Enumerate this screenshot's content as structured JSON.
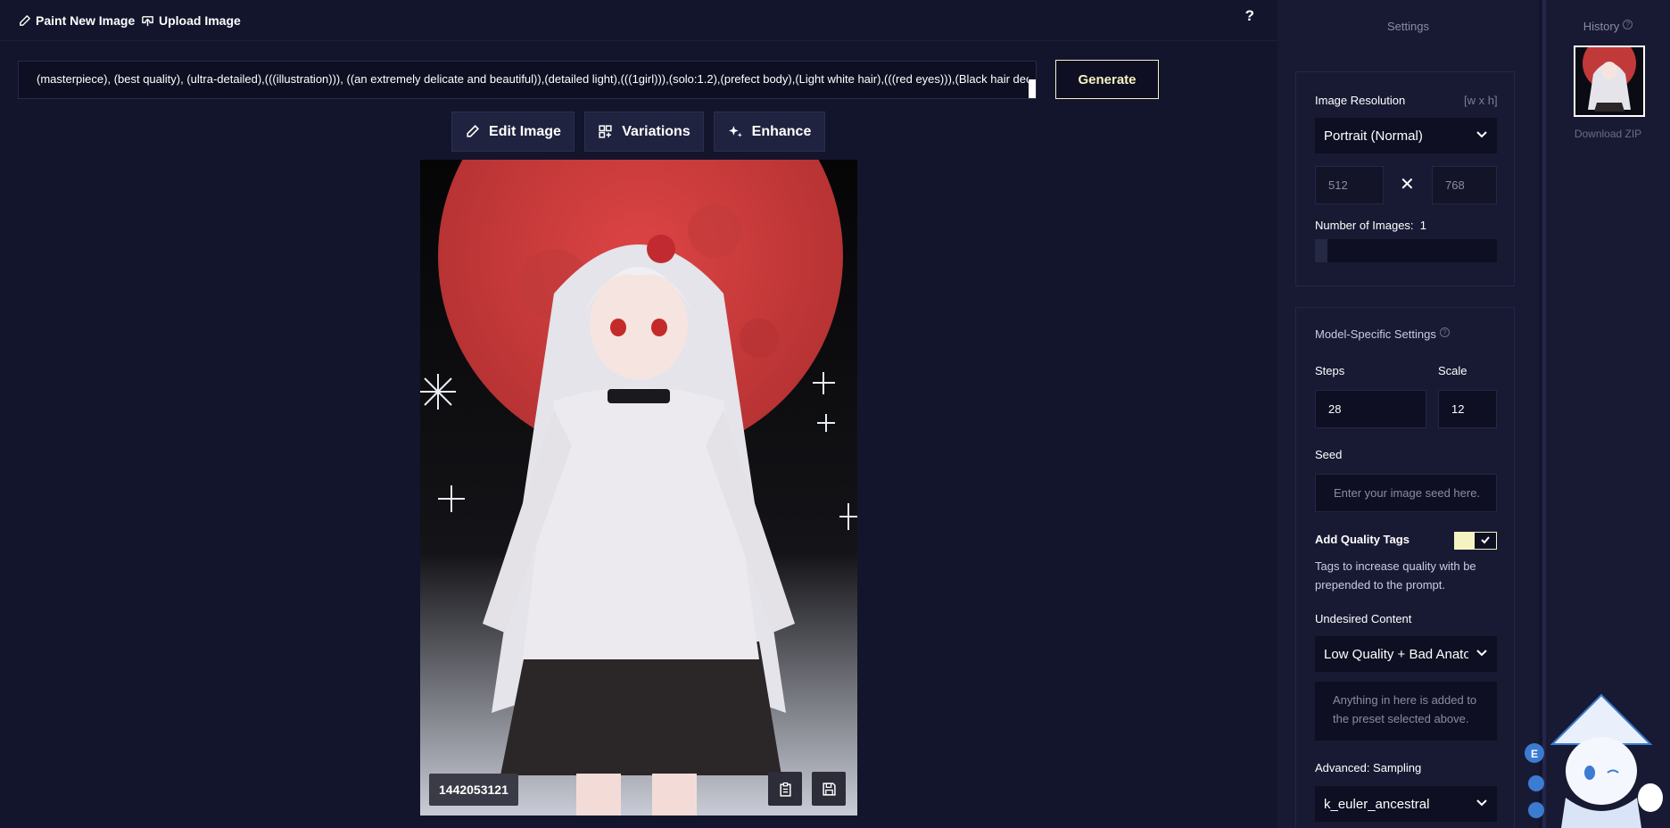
{
  "topbar": {
    "paint_new": "Paint New Image",
    "upload": "Upload Image",
    "help": "?"
  },
  "prompt": {
    "value": "(masterpiece), (best quality), (ultra-detailed),(((illustration))), ((an extremely delicate and beautiful)),(detailed light),(((1girl))),(solo:1.2),(prefect body),(Light white hair),(((red eyes))),(Black hair decoration),(black choker),white sweater,black skirt,blood moon,snowflakes"
  },
  "generate_label": "Generate",
  "actions": {
    "edit": "Edit Image",
    "variations": "Variations",
    "enhance": "Enhance"
  },
  "image": {
    "seed": "1442053121"
  },
  "settings": {
    "title": "Settings",
    "resolution_label": "Image Resolution",
    "resolution_hint": "[w x h]",
    "resolution_value": "Portrait (Normal)",
    "width_placeholder": "512",
    "height_placeholder": "768",
    "times": "✕",
    "num_images_label": "Number of Images:",
    "num_images_value": "1",
    "model_specific_label": "Model-Specific Settings",
    "steps_label": "Steps",
    "steps_value": "28",
    "scale_label": "Scale",
    "scale_value": "12",
    "seed_label": "Seed",
    "seed_placeholder": "Enter your image seed here.",
    "quality_tags_label": "Add Quality Tags",
    "quality_tags_on": true,
    "quality_tags_desc": "Tags to increase quality with be prepended to the prompt.",
    "undesired_label": "Undesired Content",
    "undesired_value": "Low Quality + Bad Anatomy",
    "undesired_placeholder": "Anything in here is added to the preset selected above.",
    "sampling_label": "Advanced: Sampling",
    "sampling_value": "k_euler_ancestral"
  },
  "history": {
    "title": "History",
    "download": "Download ZIP"
  },
  "colors": {
    "background": "#13152c",
    "panel": "#181a33",
    "input": "#0e0f22",
    "accent": "#f5f3c2",
    "moon": "#c2393a"
  },
  "icons": [
    "pencil-icon",
    "upload-icon",
    "variations-icon",
    "sparkle-icon",
    "clipboard-icon",
    "save-icon",
    "chevron-down-icon",
    "check-icon",
    "help-icon"
  ]
}
